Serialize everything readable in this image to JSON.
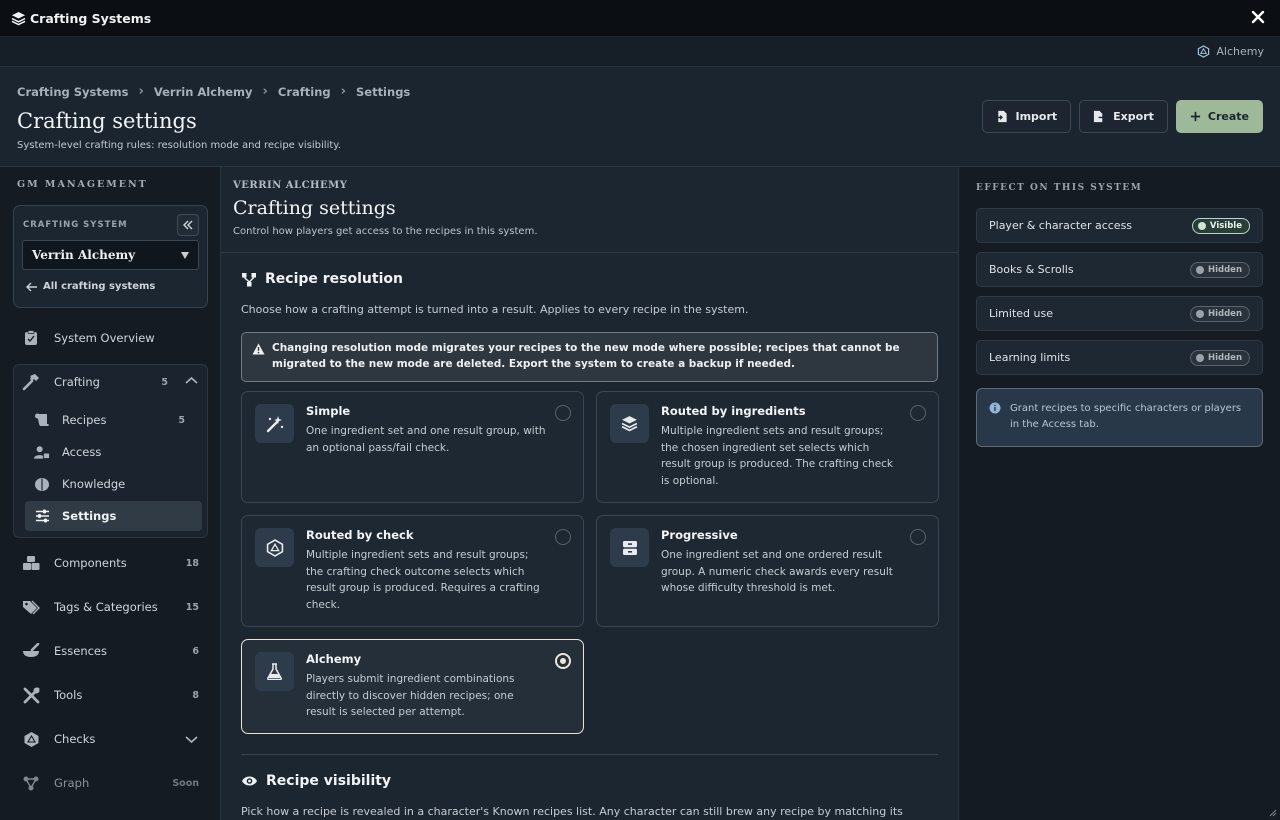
{
  "window": {
    "title": "Crafting Systems",
    "system_badge": "Alchemy"
  },
  "breadcrumb": [
    "Crafting Systems",
    "Verrin Alchemy",
    "Crafting",
    "Settings"
  ],
  "header": {
    "title": "Crafting settings",
    "subtitle": "System-level crafting rules: resolution mode and recipe visibility.",
    "import_label": "Import",
    "export_label": "Export",
    "create_label": "Create"
  },
  "sidebar": {
    "heading": "GM MANAGEMENT",
    "system_label": "CRAFTING SYSTEM",
    "selected_system": "Verrin Alchemy",
    "back_link": "All crafting systems",
    "items": [
      {
        "label": "System Overview",
        "count": ""
      },
      {
        "label": "Crafting",
        "count": "5"
      },
      {
        "label": "Components",
        "count": "18"
      },
      {
        "label": "Tags & Categories",
        "count": "15"
      },
      {
        "label": "Essences",
        "count": "6"
      },
      {
        "label": "Tools",
        "count": "8"
      },
      {
        "label": "Checks",
        "count": ""
      },
      {
        "label": "Graph",
        "count": "Soon"
      }
    ],
    "crafting_sub": [
      {
        "label": "Recipes",
        "count": "5"
      },
      {
        "label": "Access",
        "count": ""
      },
      {
        "label": "Knowledge",
        "count": ""
      },
      {
        "label": "Settings",
        "count": ""
      }
    ]
  },
  "main": {
    "eyebrow": "VERRIN ALCHEMY",
    "title": "Crafting settings",
    "description": "Control how players get access to the recipes in this system.",
    "resolution": {
      "title": "Recipe resolution",
      "description": "Choose how a crafting attempt is turned into a result. Applies to every recipe in the system.",
      "warning": "Changing resolution mode migrates your recipes to the new mode where possible; recipes that cannot be migrated to the new mode are deleted. Export the system to create a backup if needed.",
      "options": [
        {
          "title": "Simple",
          "text": "One ingredient set and one result group, with an optional pass/fail check.",
          "selected": false
        },
        {
          "title": "Routed by ingredients",
          "text": "Multiple ingredient sets and result groups; the chosen ingredient set selects which result group is produced. The crafting check is optional.",
          "selected": false
        },
        {
          "title": "Routed by check",
          "text": "Multiple ingredient sets and result groups; the crafting check outcome selects which result group is produced. Requires a crafting check.",
          "selected": false
        },
        {
          "title": "Progressive",
          "text": "One ingredient set and one ordered result group. A numeric check awards every result whose difficulty threshold is met.",
          "selected": false
        },
        {
          "title": "Alchemy",
          "text": "Players submit ingredient combinations directly to discover hidden recipes; one result is selected per attempt.",
          "selected": true
        }
      ]
    },
    "visibility": {
      "title": "Recipe visibility",
      "description": "Pick how a recipe is revealed in a character's Known recipes list. Any character can still brew any recipe by matching its ingredients."
    }
  },
  "effects": {
    "heading": "EFFECT ON THIS SYSTEM",
    "rows": [
      {
        "label": "Player & character access",
        "status": "Visible"
      },
      {
        "label": "Books & Scrolls",
        "status": "Hidden"
      },
      {
        "label": "Limited use",
        "status": "Hidden"
      },
      {
        "label": "Learning limits",
        "status": "Hidden"
      }
    ],
    "info": "Grant recipes to specific characters or players in the Access tab."
  },
  "colors": {
    "accent": "#9eb998",
    "selected_border": "#e9e4d4",
    "warning_border": "#707a83"
  }
}
